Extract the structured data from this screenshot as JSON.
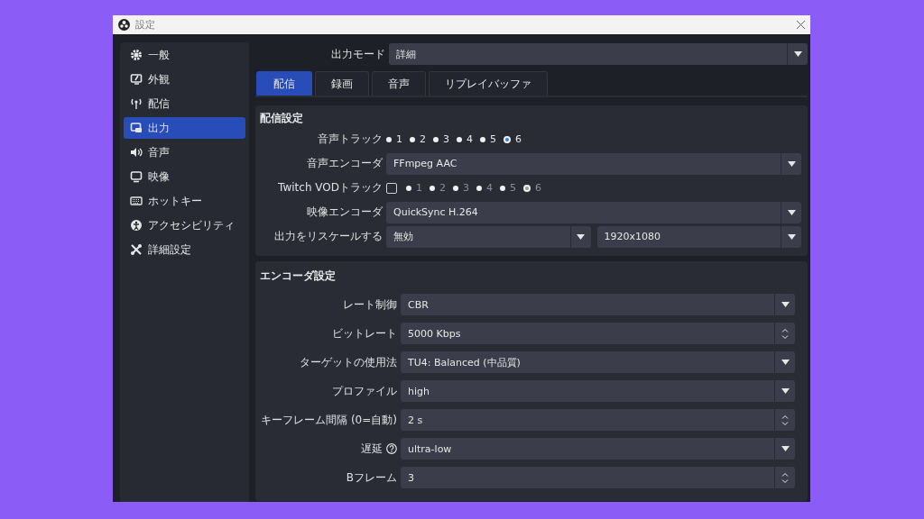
{
  "window": {
    "title": "設定"
  },
  "sidebar": {
    "items": [
      {
        "label": "一般",
        "selected": false
      },
      {
        "label": "外観",
        "selected": false
      },
      {
        "label": "配信",
        "selected": false
      },
      {
        "label": "出力",
        "selected": true
      },
      {
        "label": "音声",
        "selected": false
      },
      {
        "label": "映像",
        "selected": false
      },
      {
        "label": "ホットキー",
        "selected": false
      },
      {
        "label": "アクセシビリティ",
        "selected": false
      },
      {
        "label": "詳細設定",
        "selected": false
      }
    ]
  },
  "output_mode": {
    "label": "出力モード",
    "value": "詳細"
  },
  "tabs": [
    {
      "label": "配信",
      "selected": true
    },
    {
      "label": "録画",
      "selected": false
    },
    {
      "label": "音声",
      "selected": false
    },
    {
      "label": "リプレイバッファ",
      "selected": false
    }
  ],
  "stream_settings": {
    "title": "配信設定",
    "rows": [
      {
        "kind": "radios",
        "label": "音声トラック",
        "disabled": false,
        "options": [
          {
            "label": "1",
            "selected": false
          },
          {
            "label": "2",
            "selected": false
          },
          {
            "label": "3",
            "selected": false
          },
          {
            "label": "4",
            "selected": false
          },
          {
            "label": "5",
            "selected": false
          },
          {
            "label": "6",
            "selected": true
          }
        ]
      },
      {
        "kind": "select",
        "label": "音声エンコーダ",
        "value": "FFmpeg AAC"
      },
      {
        "kind": "radios",
        "label": "Twitch VODトラック",
        "checkbox": {
          "checked": false
        },
        "disabled": true,
        "options": [
          {
            "label": "1",
            "selected": false
          },
          {
            "label": "2",
            "selected": false
          },
          {
            "label": "3",
            "selected": false
          },
          {
            "label": "4",
            "selected": false
          },
          {
            "label": "5",
            "selected": false
          },
          {
            "label": "6",
            "selected": true
          }
        ]
      },
      {
        "kind": "select",
        "label": "映像エンコーダ",
        "value": "QuickSync H.264"
      },
      {
        "kind": "select_pair",
        "label": "出力をリスケールする",
        "values": [
          "無効",
          "1920x1080"
        ]
      }
    ]
  },
  "encoder_settings": {
    "title": "エンコーダ設定",
    "rows": [
      {
        "kind": "select",
        "label": "レート制御",
        "value": "CBR"
      },
      {
        "kind": "spin",
        "label": "ビットレート",
        "value": "5000 Kbps"
      },
      {
        "kind": "select",
        "label": "ターゲットの使用法",
        "value": "TU4: Balanced (中品質)"
      },
      {
        "kind": "select",
        "label": "プロファイル",
        "value": "high"
      },
      {
        "kind": "spin",
        "label": "キーフレーム間隔 (0=自動)",
        "value": "2 s"
      },
      {
        "kind": "select",
        "label": "遅延",
        "help": true,
        "value": "ultra-low"
      },
      {
        "kind": "spin",
        "label": "Bフレーム",
        "value": "3"
      }
    ]
  }
}
